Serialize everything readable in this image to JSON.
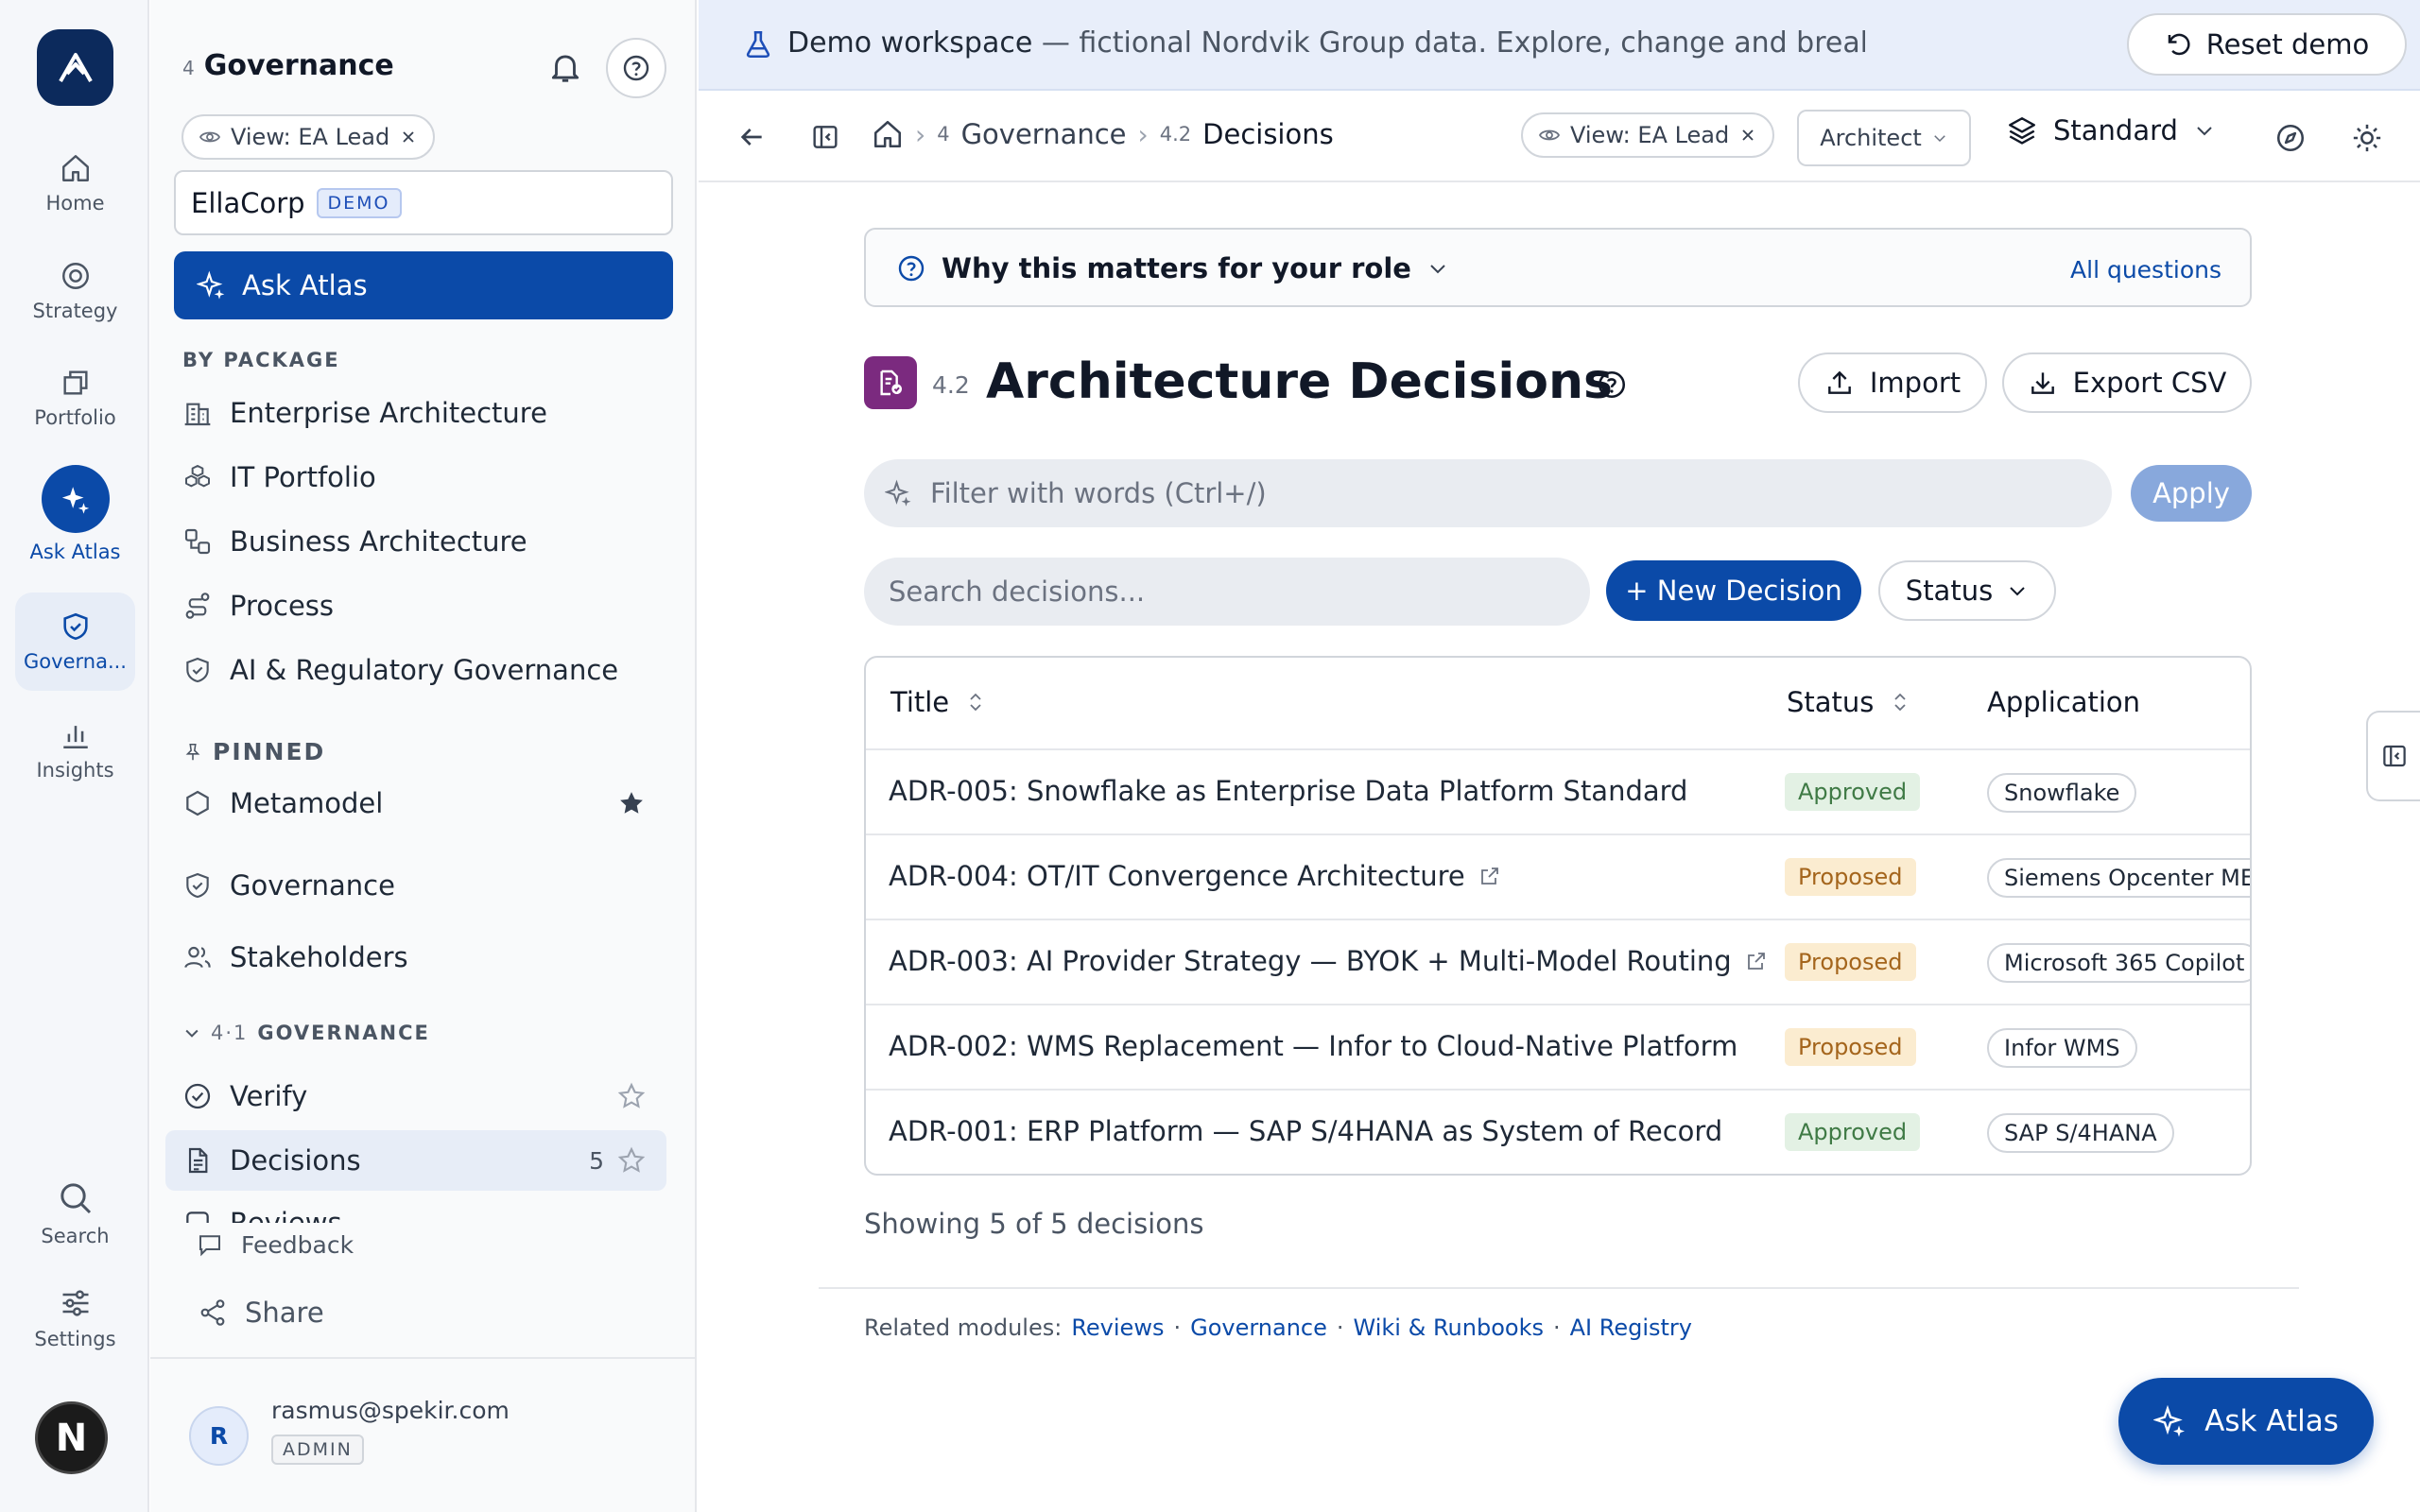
{
  "rail": {
    "items": [
      {
        "label": "Home",
        "icon": "home-icon"
      },
      {
        "label": "Strategy",
        "icon": "target-icon"
      },
      {
        "label": "Portfolio",
        "icon": "portfolio-icon"
      },
      {
        "label": "Ask Atlas",
        "icon": "sparkle-icon"
      },
      {
        "label": "Governa...",
        "icon": "shield-check-icon"
      },
      {
        "label": "Insights",
        "icon": "bar-chart-icon"
      }
    ],
    "search": "Search",
    "settings": "Settings",
    "avatar_letter": "N"
  },
  "nav": {
    "title_num": "4",
    "title": "Governance",
    "view_chip": "View: EA Lead",
    "org_name": "EllaCorp",
    "org_badge": "DEMO",
    "ask_label": "Ask Atlas",
    "by_package_heading": "BY PACKAGE",
    "packages": [
      "Enterprise Architecture",
      "IT Portfolio",
      "Business Architecture",
      "Process",
      "AI & Regulatory Governance"
    ],
    "pinned_heading": "PINNED",
    "pinned": [
      "Metamodel",
      "Governance",
      "Stakeholders"
    ],
    "group_num": "4·1",
    "group_heading": "GOVERNANCE",
    "group_items": [
      {
        "label": "Verify",
        "count": ""
      },
      {
        "label": "Decisions",
        "count": "5"
      },
      {
        "label": "Reviews",
        "count": ""
      }
    ],
    "feedback": "Feedback",
    "share": "Share",
    "user_initial": "R",
    "user_email": "rasmus@spekir.com",
    "user_role": "ADMIN"
  },
  "banner": {
    "lead": "Demo workspace",
    "text": " — fictional Nordvik Group data. Explore, change and break anything; reset brin...",
    "reset": "Reset demo"
  },
  "topbar": {
    "crumb1_num": "4",
    "crumb1": "Governance",
    "crumb2_num": "4.2",
    "crumb2": "Decisions",
    "view_chip": "View: EA Lead",
    "role_select": "Architect",
    "mode_select": "Standard"
  },
  "main": {
    "why_label": "Why this matters for your role",
    "why_link": "All questions",
    "page_num": "4.2",
    "page_title": "Architecture Decisions",
    "import_label": "Import",
    "export_label": "Export CSV",
    "filter_placeholder": "Filter with words (Ctrl+/)",
    "apply_label": "Apply",
    "search_placeholder": "Search decisions...",
    "new_label": "+ New Decision",
    "status_filter": "Status",
    "columns": [
      "Title",
      "Status",
      "Application"
    ],
    "rows": [
      {
        "title": "ADR-005: Snowflake as Enterprise Data Platform Standard",
        "status": "Approved",
        "app": "Snowflake",
        "external": false
      },
      {
        "title": "ADR-004: OT/IT Convergence Architecture",
        "status": "Proposed",
        "app": "Siemens Opcenter MES",
        "external": true
      },
      {
        "title": "ADR-003: AI Provider Strategy — BYOK + Multi-Model Routing",
        "status": "Proposed",
        "app": "Microsoft 365 Copilot",
        "external": true
      },
      {
        "title": "ADR-002: WMS Replacement — Infor to Cloud-Native Platform",
        "status": "Proposed",
        "app": "Infor WMS",
        "external": false
      },
      {
        "title": "ADR-001: ERP Platform — SAP S/4HANA as System of Record",
        "status": "Approved",
        "app": "SAP S/4HANA",
        "external": false
      }
    ],
    "showing": "Showing 5 of 5 decisions",
    "related_label": "Related modules:",
    "related_links": [
      "Reviews",
      "Governance",
      "Wiki & Runbooks",
      "AI Registry"
    ],
    "fab_label": "Ask Atlas"
  },
  "colors": {
    "primary": "#0b4aa8",
    "approved": "#3f7a45",
    "proposed": "#a4651c",
    "page_icon": "#7b2a7f"
  }
}
